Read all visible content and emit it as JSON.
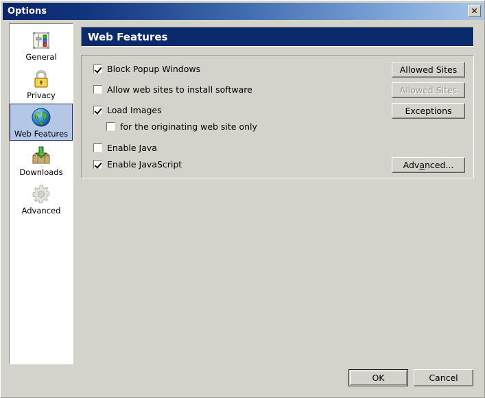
{
  "window": {
    "title": "Options",
    "close_label": "✕",
    "bg_color": "#d3d3cb"
  },
  "sidebar": {
    "items": [
      {
        "label": "General",
        "icon": "sliders-icon",
        "selected": false
      },
      {
        "label": "Privacy",
        "icon": "lock-icon",
        "selected": false
      },
      {
        "label": "Web Features",
        "icon": "globe-icon",
        "selected": true
      },
      {
        "label": "Downloads",
        "icon": "download-box-icon",
        "selected": false
      },
      {
        "label": "Advanced",
        "icon": "gear-icon",
        "selected": false
      }
    ],
    "selected_index": 2
  },
  "panel": {
    "title": "Web Features",
    "header_color": "#0a2a6b",
    "checkboxes": [
      {
        "label": "Block Popup Windows",
        "checked": true,
        "indented": false
      },
      {
        "label": "Allow web sites to install software",
        "checked": false,
        "indented": false
      },
      {
        "label": "Load Images",
        "checked": true,
        "indented": false
      },
      {
        "label": "for the originating web site only",
        "checked": false,
        "indented": true
      },
      {
        "label": "Enable Java",
        "checked": false,
        "indented": false
      },
      {
        "label": "Enable JavaScript",
        "checked": true,
        "indented": false
      }
    ],
    "side_buttons": [
      {
        "label": "Allowed Sites",
        "enabled": true
      },
      {
        "label": "Allowed Sites",
        "enabled": false
      },
      {
        "label": "Exceptions",
        "enabled": true
      }
    ],
    "advanced_button": {
      "label": "Advanced...",
      "accel_prefix": "Adv",
      "accel_char": "a",
      "accel_suffix": "nced..."
    }
  },
  "footer": {
    "ok_label": "OK",
    "cancel_label": "Cancel"
  }
}
